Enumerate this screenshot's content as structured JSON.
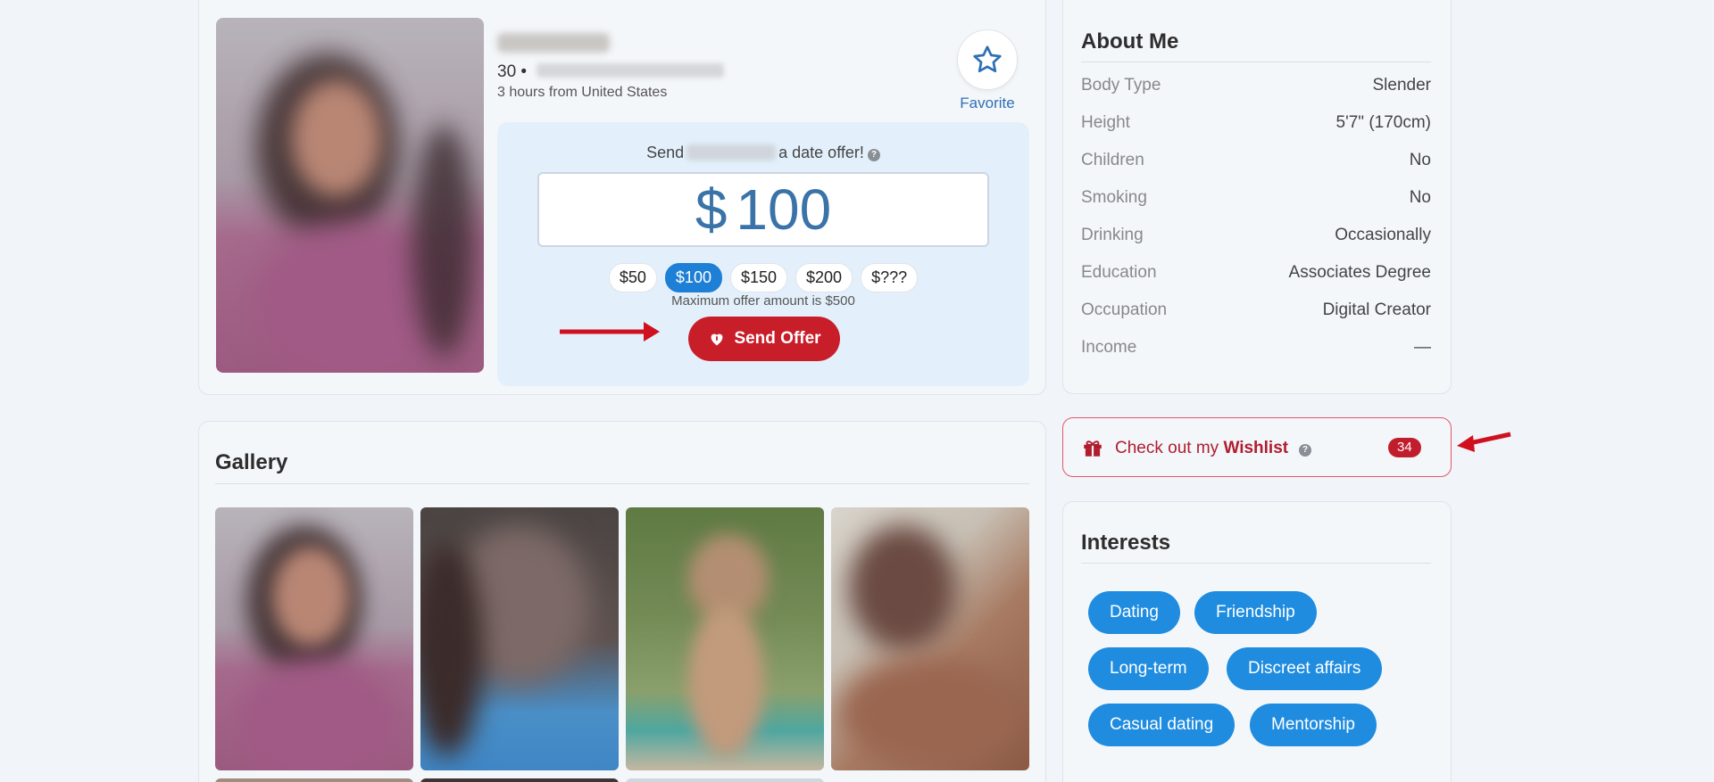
{
  "profile": {
    "age_prefix": "30 •",
    "distance": "3 hours from United States",
    "favorite_label": "Favorite"
  },
  "offer": {
    "title_before": "Send",
    "title_after": "a date offer!",
    "help_glyph": "?",
    "currency_symbol": "$",
    "amount": "100",
    "chips": [
      "$50",
      "$100",
      "$150",
      "$200",
      "$???"
    ],
    "selected_chip": "$100",
    "max_note": "Maximum offer amount is $500",
    "send_label": "Send Offer"
  },
  "about": {
    "title": "About Me",
    "rows": [
      {
        "k": "Body Type",
        "v": "Slender"
      },
      {
        "k": "Height",
        "v": "5'7\" (170cm)"
      },
      {
        "k": "Children",
        "v": "No"
      },
      {
        "k": "Smoking",
        "v": "No"
      },
      {
        "k": "Drinking",
        "v": "Occasionally"
      },
      {
        "k": "Education",
        "v": "Associates Degree"
      },
      {
        "k": "Occupation",
        "v": "Digital Creator"
      },
      {
        "k": "Income",
        "v": "—"
      }
    ]
  },
  "wishlist": {
    "label_prefix": "Check out my",
    "label_bold": "Wishlist",
    "help_glyph": "?",
    "count": "34"
  },
  "gallery": {
    "title": "Gallery"
  },
  "interests": {
    "title": "Interests",
    "tags": [
      "Dating",
      "Friendship",
      "Long-term",
      "Discreet affairs",
      "Casual dating",
      "Mentorship"
    ]
  },
  "colors": {
    "accent_blue": "#1f8ce0",
    "offer_red": "#c81e2a",
    "annotation_arrow": "#d0101f"
  },
  "icons": {
    "favorite": "star-icon",
    "send_offer": "heart-icon",
    "wishlist": "gift-icon"
  }
}
